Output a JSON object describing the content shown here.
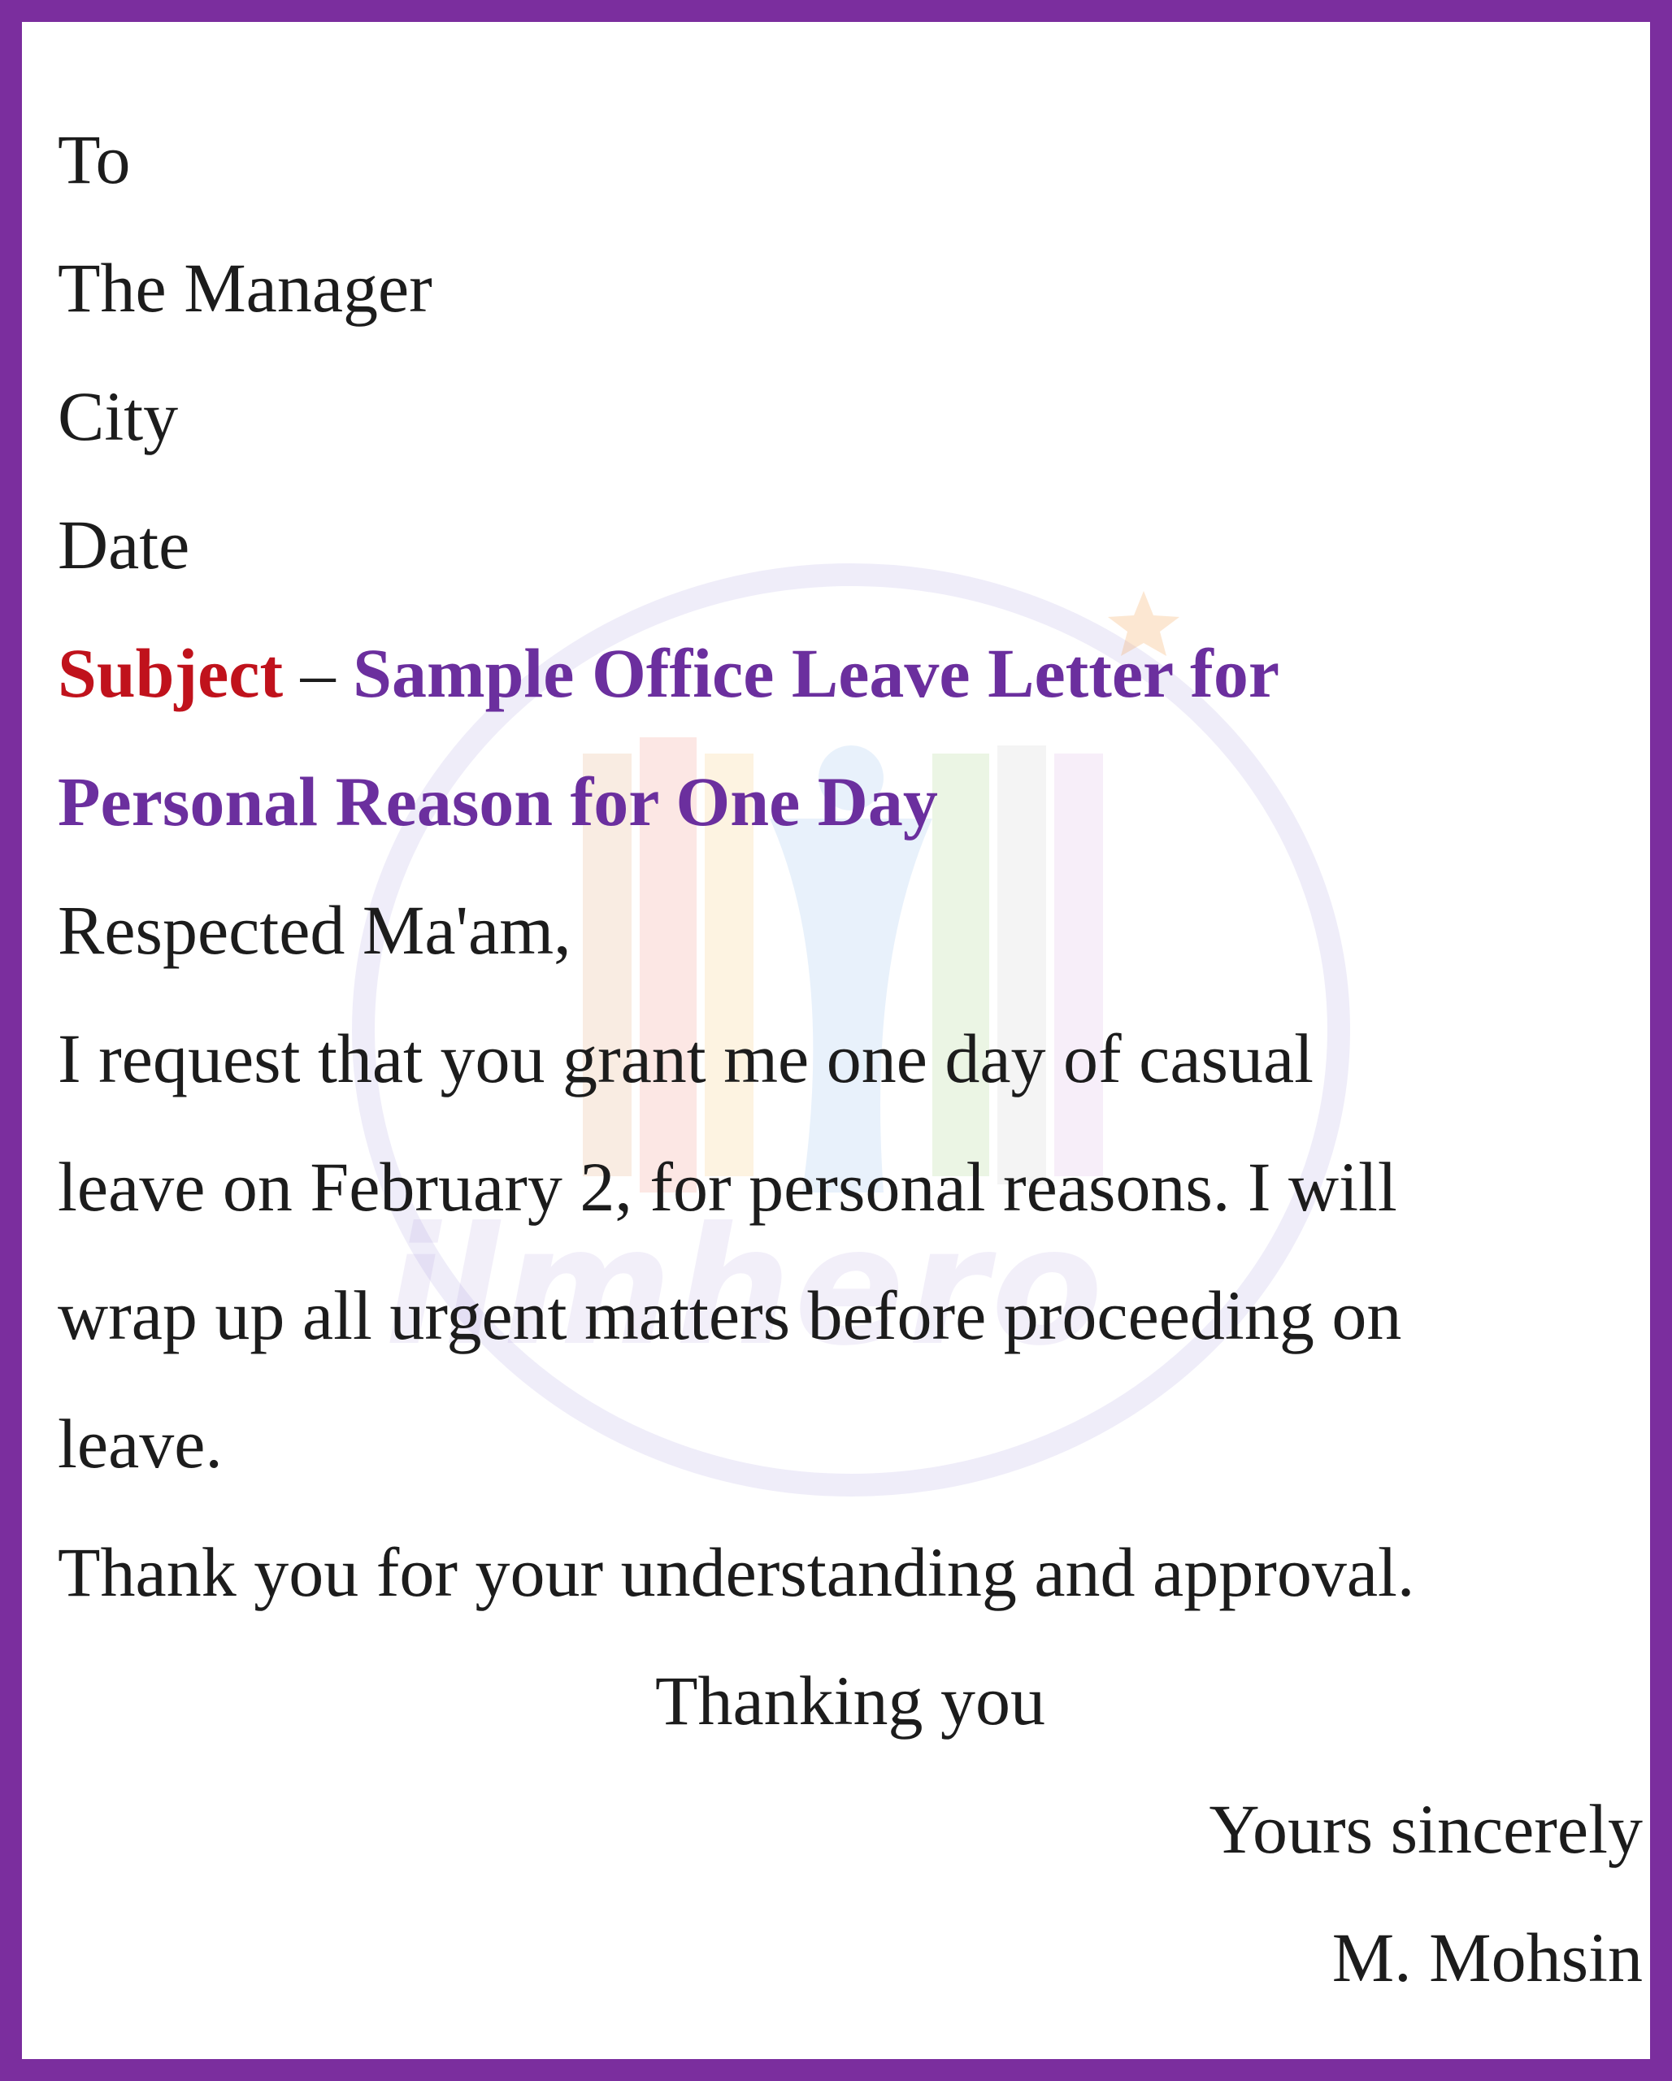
{
  "recipient": {
    "to": "To",
    "name": "The Manager",
    "city": "City",
    "date": "Date"
  },
  "subject": {
    "label": "Subject",
    "dash": " – ",
    "line1": "Sample Office Leave Letter for",
    "line2": "Personal Reason for One Day"
  },
  "salutation": "Respected Ma'am,",
  "body": {
    "lines": [
      "I request that you grant me one day of casual",
      "leave on February 2, for personal reasons. I will",
      "wrap up all urgent matters before proceeding on",
      "leave."
    ],
    "thanks": "Thank you for your understanding and approval."
  },
  "closing": {
    "thanking": "Thanking you",
    "sign_off": "Yours sincerely",
    "signature": "M. Mohsin"
  },
  "watermark": {
    "text": "ilmhero",
    "icon": "open-book-logo-icon"
  },
  "colors": {
    "border": "#7b2e9e",
    "subject_label": "#c0121c",
    "subject_text": "#6b2f9e",
    "body_text": "#1c1c1c"
  }
}
